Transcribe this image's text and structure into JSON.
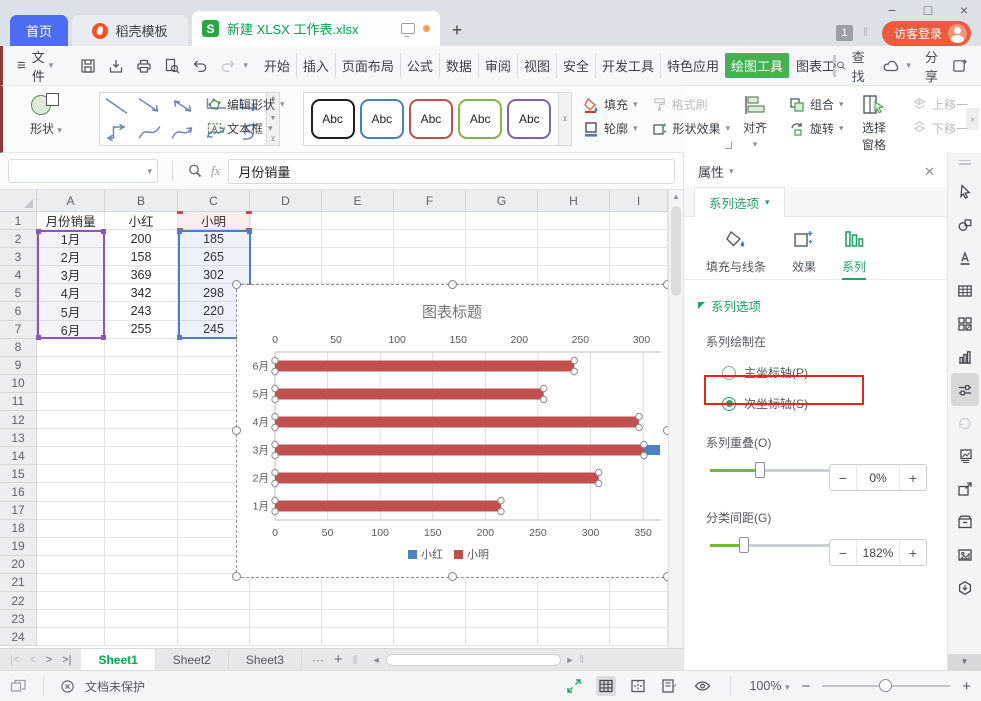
{
  "window": {
    "controls": {
      "minimize": "−",
      "maximize": "□",
      "close": "×"
    },
    "tabs": {
      "home": "首页",
      "docer": "稻壳模板",
      "document": "新建 XLSX 工作表.xlsx"
    },
    "badge": "1",
    "login_label": "访客登录"
  },
  "menu": {
    "file_label": "文件",
    "quick_icons": [
      "save",
      "output",
      "print",
      "preview",
      "undo",
      "redo"
    ],
    "tabs": [
      "开始",
      "插入",
      "页面布局",
      "公式",
      "数据",
      "审阅",
      "视图",
      "安全",
      "开发工具",
      "特色应用"
    ],
    "active_tab": "绘图工具",
    "overflow_tab": "图表工具",
    "find_label": "查找",
    "share_label": "分享",
    "help_label": "?",
    "more_label": "⋮",
    "collapse_label": "∧"
  },
  "toolbar": {
    "shapes_label": "形状",
    "shape_gallery": [
      "line",
      "arrow",
      "double-arrow",
      "elbow",
      "elbow-arrow",
      "elbow-double",
      "curve",
      "curve-arrow",
      "curve-double",
      "freeform-s"
    ],
    "edit_shape_label": "编辑形状",
    "textbox_label": "文本框",
    "abc_label": "Abc",
    "abc_colors": [
      "#1f1f1f",
      "#4a7ebb",
      "#c0504d",
      "#86b24a",
      "#8064a2"
    ],
    "fill_label": "填充",
    "format_painter_label": "格式刷",
    "outline_label": "轮廓",
    "shape_effects_label": "形状效果",
    "align_label": "对齐",
    "group_label": "组合",
    "rotate_label": "旋转",
    "selection_pane_label": "选择窗格",
    "move_up_label": "上移一",
    "move_down_label": "下移一"
  },
  "formula_bar": {
    "name_box": "",
    "fx": "fx",
    "value": "月份销量"
  },
  "sheet": {
    "columns": [
      "A",
      "B",
      "C",
      "D",
      "E",
      "F",
      "G",
      "H",
      "I"
    ],
    "row_count": 24,
    "data": [
      [
        "月份销量",
        "小红",
        "小明"
      ],
      [
        "1月",
        "200",
        "185"
      ],
      [
        "2月",
        "158",
        "265"
      ],
      [
        "3月",
        "369",
        "302"
      ],
      [
        "4月",
        "342",
        "298"
      ],
      [
        "5月",
        "243",
        "220"
      ],
      [
        "6月",
        "255",
        "245"
      ]
    ]
  },
  "chart_data": {
    "type": "bar",
    "orientation": "horizontal",
    "title": "图表标题",
    "categories": [
      "1月",
      "2月",
      "3月",
      "4月",
      "5月",
      "6月"
    ],
    "series": [
      {
        "name": "小红",
        "color": "#4F81BD",
        "axis": "primary",
        "values": [
          200,
          158,
          369,
          342,
          243,
          255
        ]
      },
      {
        "name": "小明",
        "color": "#C0504D",
        "axis": "secondary",
        "values": [
          185,
          265,
          302,
          298,
          220,
          245
        ]
      }
    ],
    "primary_axis": {
      "position": "bottom",
      "ticks": [
        0,
        50,
        100,
        150,
        200,
        250,
        300,
        350
      ],
      "max": 367
    },
    "secondary_axis": {
      "position": "top",
      "ticks": [
        0,
        50,
        100,
        150,
        200,
        250,
        300
      ],
      "max": 316
    },
    "legend": [
      "小红",
      "小明"
    ],
    "legend_position": "bottom",
    "grid": true,
    "selected_series": "小明"
  },
  "panel": {
    "title": "属性",
    "tab_label": "系列选项",
    "views": [
      {
        "label": "填充与线条",
        "icon": "bucket",
        "active": false
      },
      {
        "label": "效果",
        "icon": "effects",
        "active": false
      },
      {
        "label": "系列",
        "icon": "series",
        "active": true
      }
    ],
    "section_label": "系列选项",
    "plot_on_label": "系列绘制在",
    "radio_primary": "主坐标轴(P)",
    "radio_secondary": "次坐标轴(S)",
    "selected_radio": "次坐标轴(S)",
    "overlap_label": "系列重叠(O)",
    "overlap_value": "0%",
    "gap_label": "分类间距(G)",
    "gap_value": "182%",
    "stepper_minus": "−",
    "stepper_plus": "+"
  },
  "right_rail": {
    "icons": [
      "cursor",
      "shapes",
      "wordart",
      "table",
      "apps",
      "chart",
      "sliders",
      "refresh",
      "gallery",
      "export",
      "archive",
      "image",
      "stamp"
    ],
    "active_icon": "sliders"
  },
  "sheet_tabs": {
    "sheets": [
      "Sheet1",
      "Sheet2",
      "Sheet3"
    ],
    "active": "Sheet1",
    "more_label": "···",
    "add_label": "+"
  },
  "status_bar": {
    "protection_label": "文档未保护",
    "zoom_value": "100%",
    "zoom_minus": "−",
    "zoom_plus": "+"
  }
}
